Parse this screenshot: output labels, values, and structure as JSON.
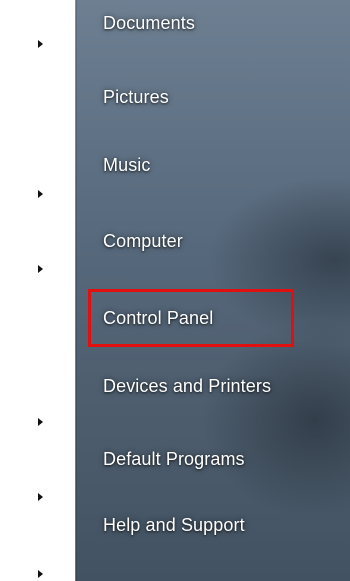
{
  "start_menu": {
    "right_pane_items": [
      {
        "label": "Documents",
        "has_submenu": true
      },
      {
        "label": "Pictures",
        "has_submenu": false
      },
      {
        "label": "Music",
        "has_submenu": true
      },
      {
        "label": "Computer",
        "has_submenu": true
      },
      {
        "label": "Control Panel",
        "has_submenu": false,
        "highlighted": true
      },
      {
        "label": "Devices and Printers",
        "has_submenu": true
      },
      {
        "label": "Default Programs",
        "has_submenu": true
      },
      {
        "label": "Help and Support",
        "has_submenu": true
      }
    ],
    "highlight_color": "#e01010",
    "label_color": "#ffffff"
  }
}
